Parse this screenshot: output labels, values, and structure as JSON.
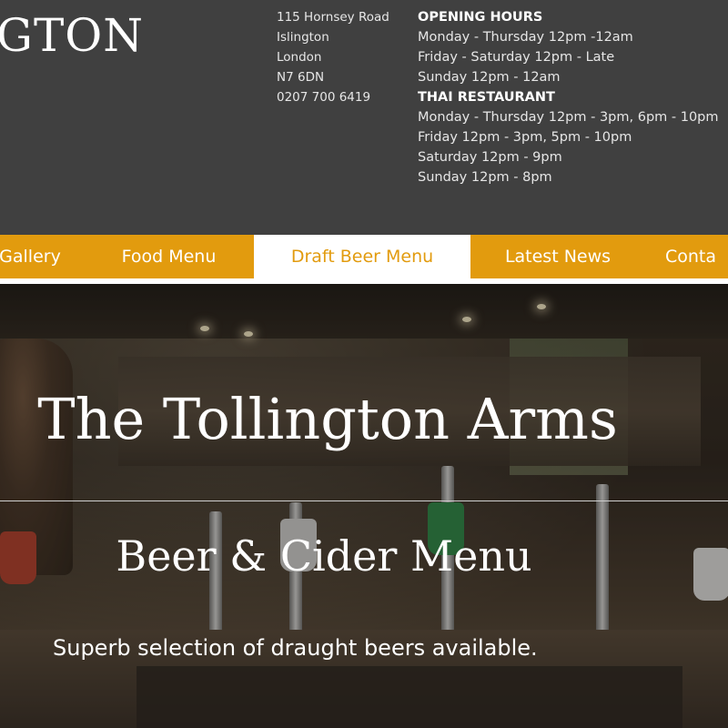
{
  "header": {
    "logo_text": "GTON",
    "address": {
      "line1": "115 Hornsey Road",
      "line2": "Islington",
      "line3": "London",
      "line4": "N7 6DN",
      "phone": "0207 700 6419"
    },
    "opening_hours": {
      "heading": "OPENING HOURS",
      "lines": [
        "Monday - Thursday 12pm -12am",
        "Friday - Saturday 12pm - Late",
        "Sunday 12pm - 12am"
      ]
    },
    "thai_restaurant": {
      "heading": "THAI RESTAURANT",
      "lines": [
        "Monday - Thursday 12pm - 3pm, 6pm - 10pm",
        "Friday 12pm - 3pm, 5pm - 10pm",
        "Saturday 12pm - 9pm",
        "Sunday 12pm - 8pm"
      ]
    }
  },
  "nav": {
    "items": [
      {
        "label": "Gallery"
      },
      {
        "label": "Food Menu"
      },
      {
        "label": "Draft Beer Menu",
        "active": true
      },
      {
        "label": "Latest News"
      },
      {
        "label": "Conta"
      }
    ]
  },
  "hero": {
    "title": "The Tollington Arms",
    "subtitle": "Beer & Cider Menu",
    "text": "Superb selection of draught beers available."
  },
  "colors": {
    "header_bg": "#404040",
    "nav_bg": "#e29b0e",
    "nav_active_text": "#e29b0e",
    "text_white": "#ffffff"
  }
}
